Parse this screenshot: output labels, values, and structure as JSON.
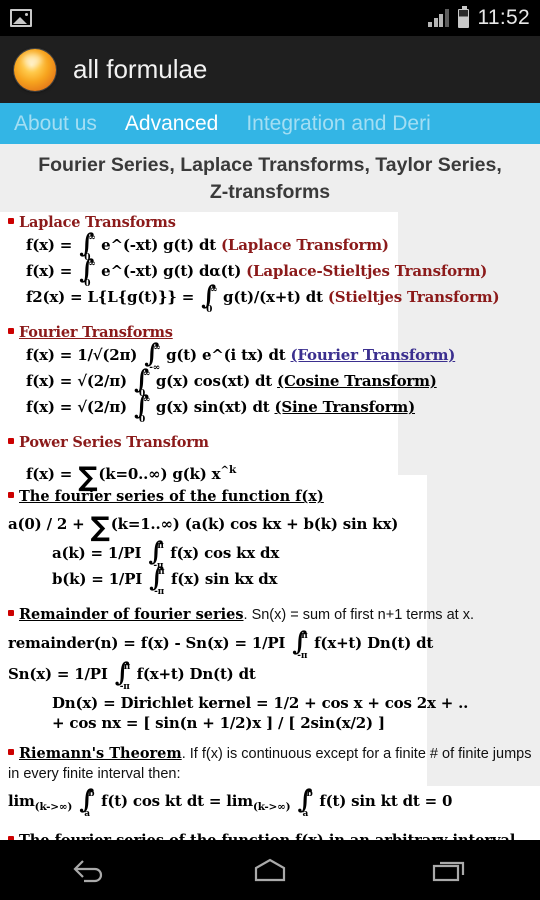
{
  "status_bar": {
    "notification_icon": "image-icon",
    "signal_icon": "signal-bars-icon",
    "battery_icon": "battery-icon",
    "time": "11:52"
  },
  "action_bar": {
    "app_icon": "app-logo-icon",
    "title": "all formulae"
  },
  "tabs": [
    {
      "label": "About us",
      "active": false
    },
    {
      "label": "Advanced",
      "active": true
    },
    {
      "label": "Integration and Deri",
      "active": false
    }
  ],
  "page": {
    "title": "Fourier Series, Laplace Transforms, Taylor Series, Z-transforms"
  },
  "colors": {
    "accent": "#33b5e5",
    "action_bar": "#1f1f1f",
    "status_bar": "#000000",
    "page_background": "#eeeeee",
    "sheet": "#ffffff",
    "heading_red": "#8b1a1a",
    "bullet_red": "#cc0000",
    "link_purple": "#3b2f8f"
  },
  "sections": [
    {
      "heading": "Laplace Transforms",
      "heading_underlined": false,
      "equations": [
        {
          "lhs": "f(x) =",
          "integral_hi": "∞",
          "integral_lo": "0",
          "body": "e^(-xt) g(t) dt",
          "note": "(Laplace Transform)"
        },
        {
          "lhs": "f(x) =",
          "integral_hi": "∞",
          "integral_lo": "0",
          "body": "e^(-xt) g(t) dα(t)",
          "note": "(Laplace-Stieltjes Transform)"
        },
        {
          "lhs": "f2(x) = L{L{g(t)}} =",
          "integral_hi": "∞",
          "integral_lo": "0",
          "body": "g(t)/(x+t) dt",
          "note": "(Stieltjes Transform)"
        }
      ]
    },
    {
      "heading": "Fourier Transforms",
      "heading_underlined": true,
      "equations": [
        {
          "lhs": "f(x) = 1/√(2π)",
          "integral_hi": "∞",
          "integral_lo": "-∞",
          "body": "g(t) e^(i tx) dt",
          "link": "(Fourier Transform)"
        },
        {
          "lhs": "f(x) = √(2/π)",
          "integral_hi": "∞",
          "integral_lo": "0",
          "body": "g(x) cos(xt) dt",
          "link_black": "(Cosine Transform)"
        },
        {
          "lhs": "f(x) = √(2/π)",
          "integral_hi": "∞",
          "integral_lo": "0",
          "body": "g(x) sin(xt) dt",
          "link_black": "(Sine Transform)"
        }
      ]
    },
    {
      "heading": "Power Series Transform",
      "heading_underlined": false,
      "equations": [
        {
          "lhs": "f(x) =",
          "sigma_args": "(k=0..∞)",
          "body": "g(k) x",
          "sup": "^k"
        }
      ]
    },
    {
      "heading": "The fourier series of the function f(x)",
      "heading_black": true,
      "equations": [
        {
          "lhs": "a(0) / 2 +",
          "sigma_args": "(k=1..∞)",
          "body": "(a(k) cos kx + b(k) sin kx)"
        },
        {
          "lhs": "a(k) = 1/PI",
          "integral_hi": "π",
          "integral_lo": "-π",
          "body": "f(x) cos kx dx"
        },
        {
          "lhs": "b(k) = 1/PI",
          "integral_hi": "π",
          "integral_lo": "-π",
          "body": "f(x) sin kx dx"
        }
      ]
    },
    {
      "heading": "Remainder of fourier series",
      "heading_black": true,
      "trailing_plain": ". Sn(x) = sum of first n+1 terms at x.",
      "equations": [
        {
          "lhs": "remainder(n) = f(x) - Sn(x) = 1/PI",
          "integral_hi": "π",
          "integral_lo": "-π",
          "body": "f(x+t) Dn(t) dt"
        },
        {
          "lhs": "Sn(x) = 1/PI",
          "integral_hi": "π",
          "integral_lo": "-π",
          "body": "f(x+t) Dn(t) dt"
        }
      ],
      "kernel_line_1": "Dn(x) = Dirichlet kernel = 1/2 + cos x + cos 2x + .. + cos",
      "kernel_line_2": "nx = [ sin(n + 1/2)x ] / [ 2sin(x/2) ]"
    },
    {
      "heading": "Riemann's Theorem",
      "heading_black": true,
      "trailing_plain": ". If f(x) is continuous except for a finite # of finite jumps in every finite interval then:",
      "equations": [
        {
          "lhs": "lim",
          "sub1": "(k->∞)",
          "integral_hi": "b",
          "integral_lo": "a",
          "body": "f(t) cos kt dt = lim",
          "sub2": "(k->∞)",
          "integral2_hi": "b",
          "integral2_lo": "a",
          "body2": "f(t) sin kt dt = 0"
        }
      ]
    },
    {
      "heading": "The fourier series of the function f(x) in an arbitrary interval.",
      "heading_black": true,
      "equations": []
    }
  ],
  "nav_bar": {
    "back": "back-icon",
    "home": "home-icon",
    "recents": "recents-icon"
  }
}
